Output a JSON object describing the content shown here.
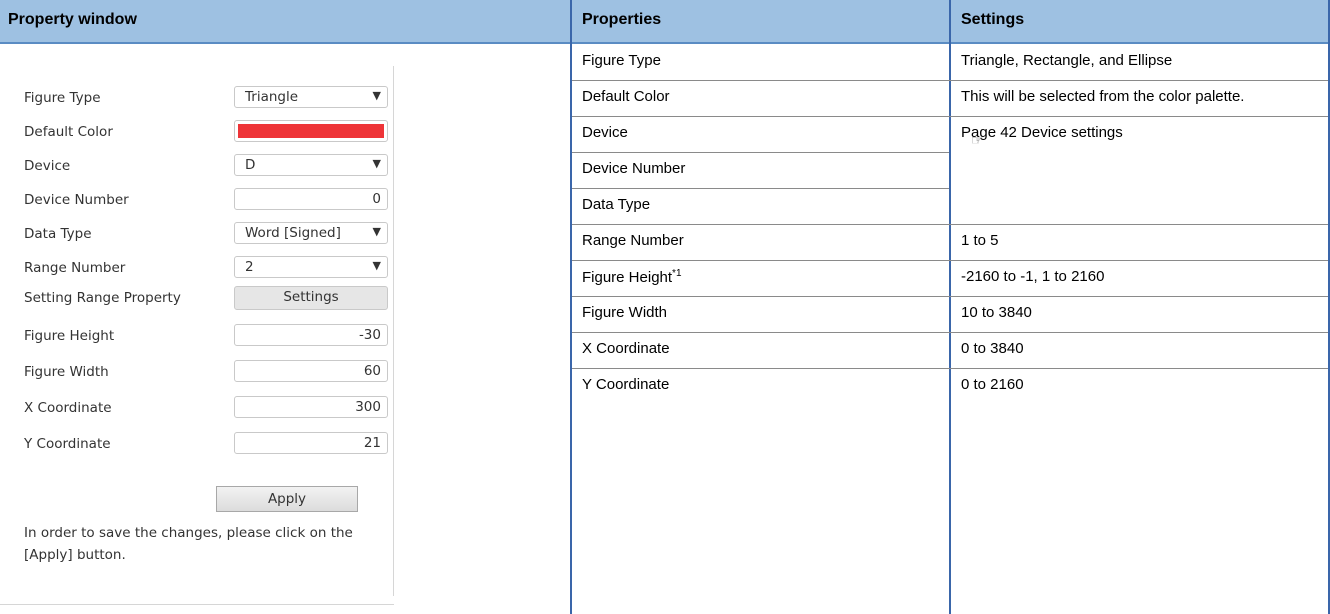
{
  "left": {
    "header": "Property window",
    "rows": [
      {
        "label": "Figure Type",
        "type": "select",
        "value": "Triangle"
      },
      {
        "label": "Default Color",
        "type": "color",
        "value": "#ee3438"
      },
      {
        "label": "Device",
        "type": "select",
        "value": "D"
      },
      {
        "label": "Device Number",
        "type": "number",
        "value": "0"
      },
      {
        "label": "Data Type",
        "type": "select",
        "value": "Word [Signed]"
      },
      {
        "label": "Range Number",
        "type": "select",
        "value": "2"
      },
      {
        "label": "Setting Range Property",
        "type": "button",
        "value": "Settings"
      },
      {
        "label": "Figure Height",
        "type": "number",
        "value": "-30"
      },
      {
        "label": "Figure Width",
        "type": "number",
        "value": "60"
      },
      {
        "label": "X Coordinate",
        "type": "number",
        "value": "300"
      },
      {
        "label": "Y Coordinate",
        "type": "number",
        "value": "21"
      }
    ],
    "apply_label": "Apply",
    "hint": "In order to save the changes, please click on the [Apply] button."
  },
  "table": {
    "headers": {
      "properties": "Properties",
      "settings": "Settings"
    },
    "rows": [
      {
        "property": "Figure Type",
        "setting": "Triangle, Rectangle, and Ellipse"
      },
      {
        "property": "Default Color",
        "setting": "This will be selected from the color palette."
      },
      {
        "property": "Device",
        "setting": "Page 42 Device settings"
      },
      {
        "property": "Device Number",
        "setting": ""
      },
      {
        "property": "Data Type",
        "setting": ""
      },
      {
        "property": "Range Number",
        "setting": "1 to 5"
      },
      {
        "property": "Figure Height",
        "sup": "*1",
        "setting": "-2160 to -1, 1 to 2160"
      },
      {
        "property": "Figure Width",
        "setting": "10 to 3840"
      },
      {
        "property": "X Coordinate",
        "setting": "0 to 3840"
      },
      {
        "property": "Y Coordinate",
        "setting": "0 to 2160"
      }
    ]
  },
  "colors": {
    "header_bg": "#9ec1e2",
    "border_blue": "#3a66aa"
  },
  "icons": {
    "reference": "page-reference-icon"
  }
}
